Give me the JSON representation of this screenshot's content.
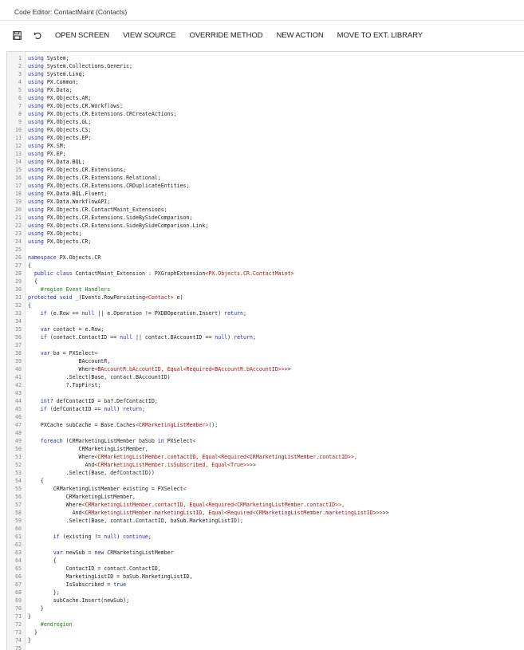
{
  "window": {
    "title": "Code Editor: ContactMaint (Contacts)"
  },
  "toolbar": {
    "save_icon": "save-icon",
    "undo_icon": "undo-icon",
    "buttons": [
      "OPEN SCREEN",
      "VIEW SOURCE",
      "OVERRIDE METHOD",
      "NEW ACTION",
      "MOVE TO EXT. LIBRARY"
    ]
  },
  "colors": {
    "keyword": "#2323c8",
    "string": "#a31515",
    "comment": "#1c7c1c",
    "text": "#222222"
  },
  "code": {
    "lines": [
      "using System;",
      "using System.Collections.Generic;",
      "using System.Linq;",
      "using PX.Common;",
      "using PX.Data;",
      "using PX.Objects.AR;",
      "using PX.Objects.CR.Workflows;",
      "using PX.Objects.CR.Extensions.CRCreateActions;",
      "using PX.Objects.GL;",
      "using PX.Objects.CS;",
      "using PX.Objects.EP;",
      "using PX.SM;",
      "using PX.EP;",
      "using PX.Data.BQL;",
      "using PX.Objects.CR.Extensions;",
      "using PX.Objects.CR.Extensions.Relational;",
      "using PX.Objects.CR.Extensions.CRDuplicateEntities;",
      "using PX.Data.BQL.Fluent;",
      "using PX.Data.WorkflowAPI;",
      "using PX.Objects.CR.ContactMaint_Extensions;",
      "using PX.Objects.CR.Extensions.SideBySideComparison;",
      "using PX.Objects.CR.Extensions.SideBySideComparison.Link;",
      "using PX.Objects;",
      "using PX.Objects.CR;",
      "",
      "namespace PX.Objects.CR",
      "{",
      "  public class ContactMaint_Extension : PXGraphExtension<PX.Objects.CR.ContactMaint>",
      "  {",
      "    #region Event Handlers",
      "protected void _(Events.RowPersisting<Contact> e)",
      "{",
      "    if (e.Row == null || e.Operation != PXDBOperation.Insert) return;",
      "",
      "    var contact = e.Row;",
      "    if (contact.ContactID == null || contact.BAccountID == null) return;",
      "",
      "    var ba = PXSelect<",
      "                BAccountR,",
      "                Where<BAccountR.bAccountID, Equal<Required<BAccountR.bAccountID>>>>",
      "            .Select(Base, contact.BAccountID)",
      "            ?.TopFirst;",
      "",
      "    int? defContactID = ba?.DefContactID;",
      "    if (defContactID == null) return;",
      "",
      "    PXCache subCache = Base.Caches<CRMarketingListMember>();",
      "",
      "    foreach (CRMarketingListMember baSub in PXSelect<",
      "                CRMarketingListMember,",
      "                Where<CRMarketingListMember.contactID, Equal<Required<CRMarketingListMember.contactID>>,",
      "                  And<CRMarketingListMember.isSubscribed, Equal<True>>>>",
      "            .Select(Base, defContactID))",
      "    {",
      "        CRMarketingListMember existing = PXSelect<",
      "            CRMarketingListMember,",
      "            Where<CRMarketingListMember.contactID, Equal<Required<CRMarketingListMember.contactID>>,",
      "              And<CRMarketingListMember.marketingListID, Equal<Required<CRMarketingListMember.marketingListID>>>>>",
      "            .Select(Base, contact.ContactID, baSub.MarketingListID);",
      "",
      "        if (existing != null) continue;",
      "",
      "        var newSub = new CRMarketingListMember",
      "        {",
      "            ContactID = contact.ContactID,",
      "            MarketingListID = baSub.MarketingListID,",
      "            IsSubscribed = true",
      "        };",
      "        subCache.Insert(newSub);",
      "    }",
      "}",
      "    #endregion",
      "  }",
      "}",
      ""
    ]
  }
}
